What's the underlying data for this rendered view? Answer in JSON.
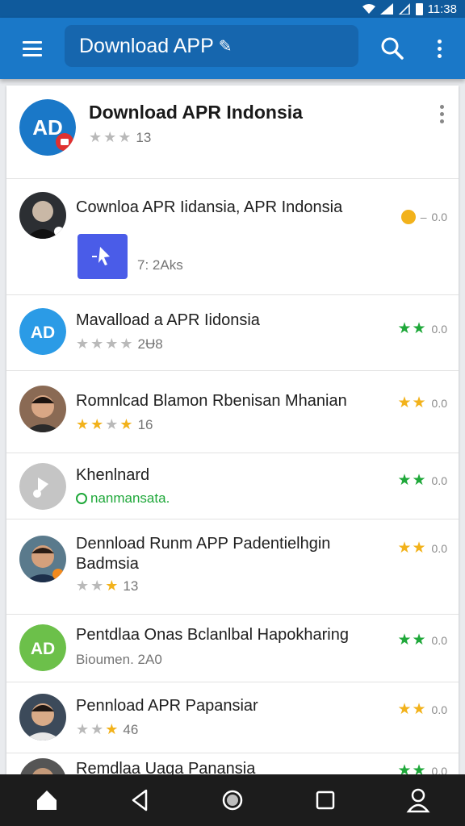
{
  "status": {
    "time": "11:38"
  },
  "app_bar": {
    "title": "Download APP",
    "title_glyph": "✎"
  },
  "header": {
    "title": "Download APR Indonsia",
    "stars_label": "13"
  },
  "items": [
    {
      "title": "Cownloa APR Iidansia, APR Indonsia",
      "sub": "7: 2Aks",
      "rating": "0.0"
    },
    {
      "title": "Mavalload a APR Iidonsia",
      "sub": "2Ʉ8",
      "rating": "0.0"
    },
    {
      "title": "Romnlcad Blamon Rbenisan Mhanian",
      "sub": "16",
      "rating": "0.0"
    },
    {
      "title": "Khenlnard",
      "sub": "nanmansata.",
      "rating": "0.0"
    },
    {
      "title": "Dennload Runm APP Padentielhgin Badmsia",
      "sub": "13",
      "rating": "0.0"
    },
    {
      "title": "Pentdlaa Onas Bclanlbal Hapokharing",
      "sub": "Bioumen. 2A0",
      "rating": "0.0"
    },
    {
      "title": "Pennload APR Papansiar",
      "sub": "46",
      "rating": "0.0"
    },
    {
      "title": "Remdlaa Uaga Panansia",
      "rating": "0.0"
    }
  ]
}
